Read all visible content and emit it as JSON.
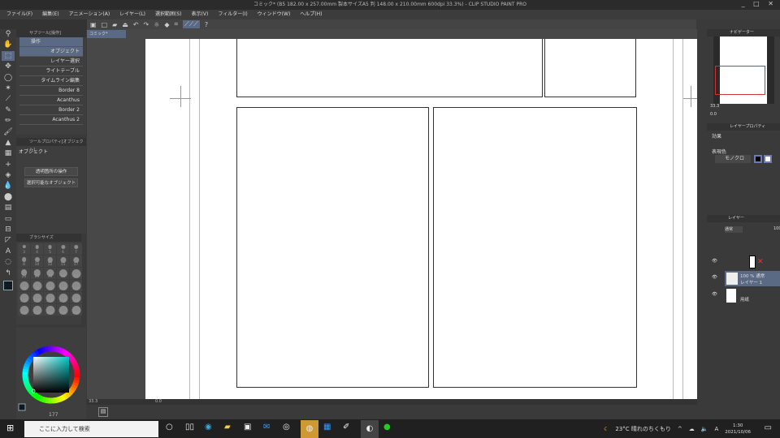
{
  "title": "コミック* (B5 182.00 x 257.00mm 製本サイズA5 判 148.00 x 210.00mm 600dpi 33.3%) - CLIP STUDIO PAINT PRO",
  "window_controls": "_ □ ✕",
  "menu": [
    "ファイル(F)",
    "編集(E)",
    "アニメーション(A)",
    "レイヤー(L)",
    "選択範囲(S)",
    "表示(V)",
    "フィルター(I)",
    "ウィンドウ(W)",
    "ヘルプ(H)"
  ],
  "doc_tab": "コミック*",
  "subtool": {
    "panel_title": "サブツール[操作]",
    "group": "操作",
    "items": [
      "オブジェクト",
      "レイヤー選択",
      "ライトテーブル",
      "タイムライン編集",
      "Border 8",
      "Acanthus",
      "Border 2",
      "Acanthus 2"
    ],
    "selected": 0
  },
  "tool_property": {
    "panel_title": "ツールプロパティ[オブジェクト]",
    "name": "オブジェクト",
    "dropdowns": [
      "透明箇所の操作",
      "選択可能なオブジェクト"
    ]
  },
  "brush_size": {
    "panel_title": "ブラシサイズ",
    "sizes": [
      3,
      4,
      5,
      6,
      7,
      8,
      10,
      12,
      15,
      17,
      20,
      25,
      30,
      40,
      50,
      60,
      70,
      80,
      100,
      120,
      150,
      170,
      200,
      250,
      300,
      400,
      500,
      600,
      700,
      800
    ]
  },
  "color": {
    "main": "#111820",
    "sub": "#000000",
    "hue_color": "#00c8c8",
    "readout": [
      "177",
      "0",
      "0"
    ]
  },
  "status": {
    "zoom": "33.3",
    "angle": "0.0"
  },
  "navigator": {
    "tab": "ナビゲーター",
    "zoom": "33.3",
    "angle": "0.0"
  },
  "layer_property": {
    "tab": "レイヤープロパティ",
    "effect_label": "効果",
    "expression_label": "表現色",
    "expression_value": "モノクロ"
  },
  "layers": {
    "tab": "レイヤー",
    "blend": "通常",
    "opacity": "100",
    "items": [
      {
        "name": "",
        "type": "frame"
      },
      {
        "name": "レイヤー 1",
        "info": "100 % 通常",
        "selected": true
      },
      {
        "name": "用紙",
        "type": "paper"
      }
    ]
  },
  "taskbar": {
    "search_placeholder": "ここに入力して検索",
    "weather": "23°C 晴れのちくもり",
    "ime": "A",
    "time": "1:30",
    "date": "2021/10/06"
  }
}
